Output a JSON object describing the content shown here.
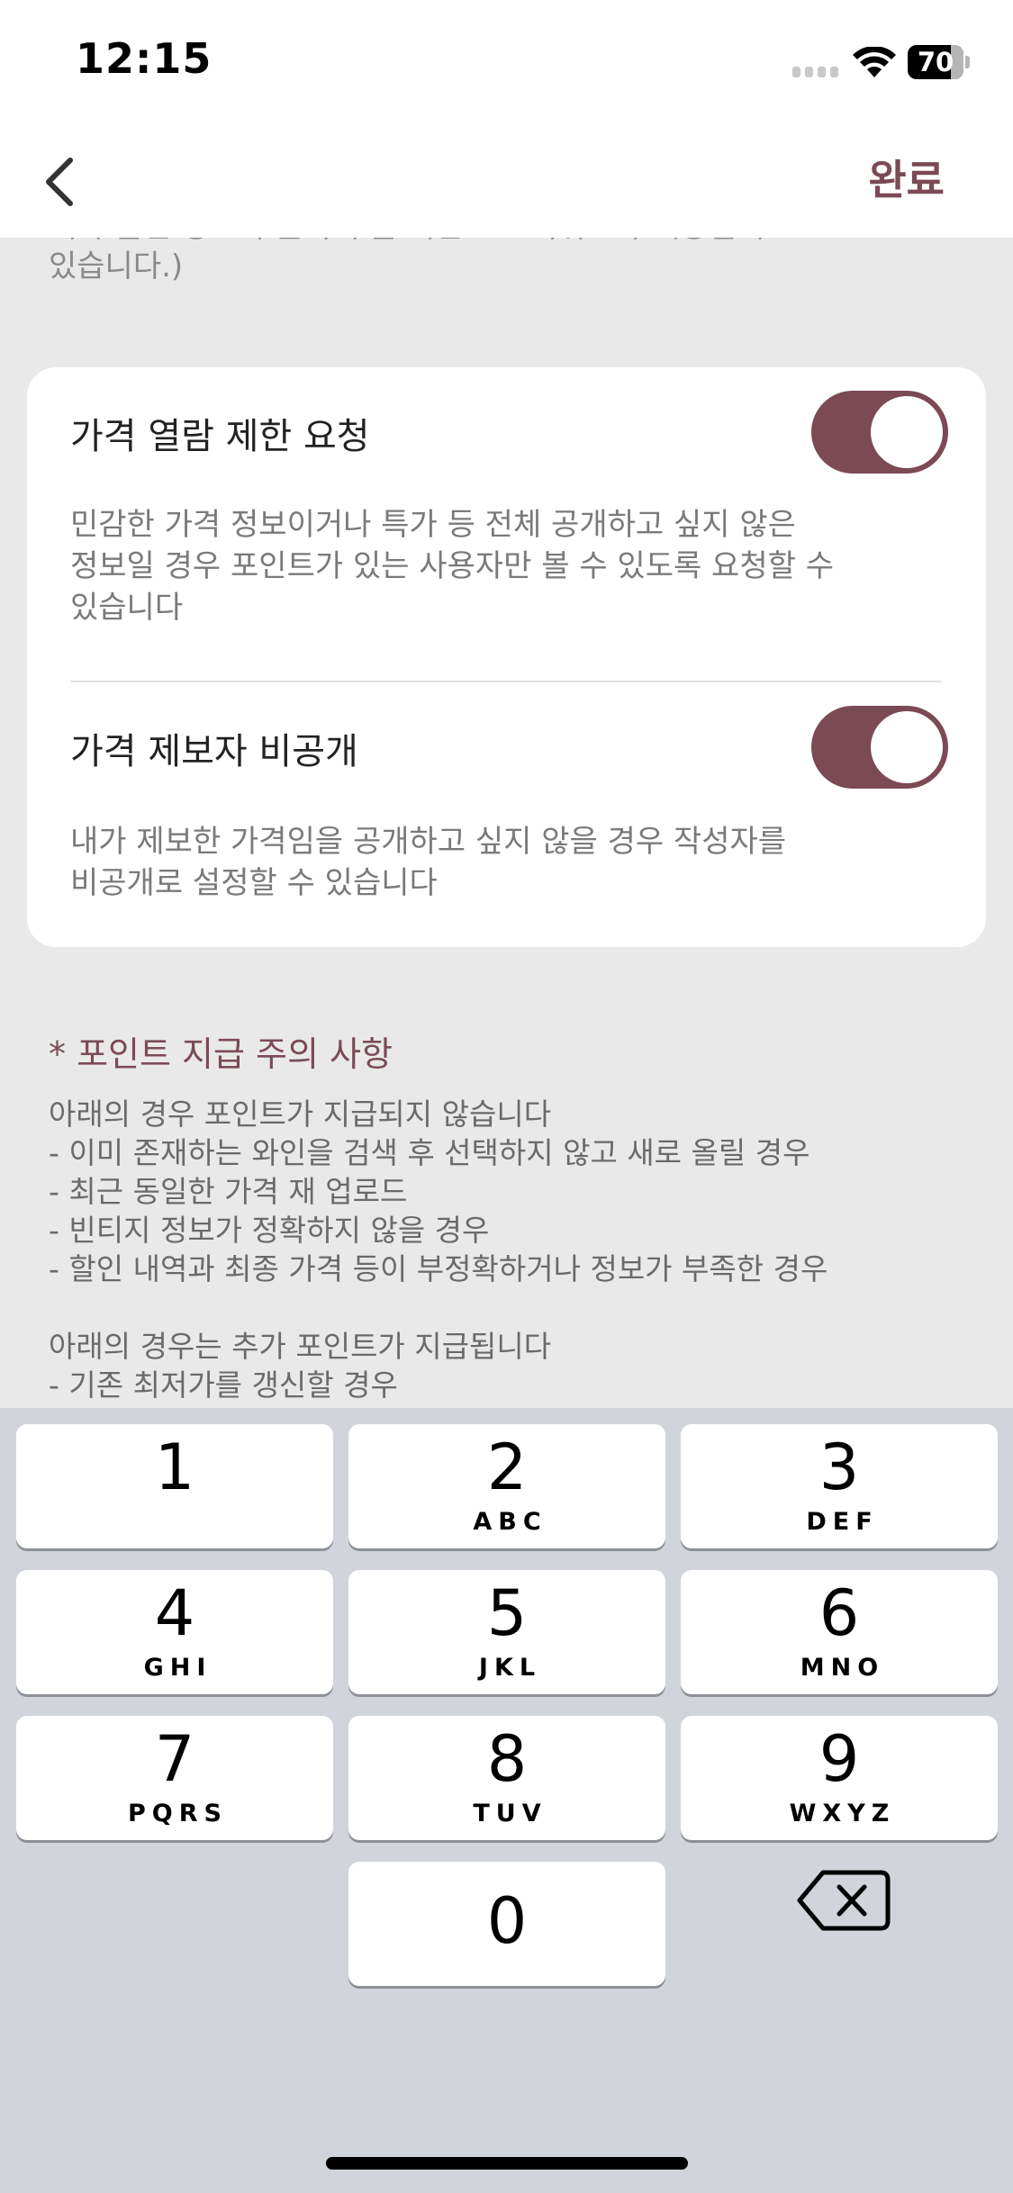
{
  "status_bar": {
    "time": "12:15",
    "battery_percent": "70"
  },
  "nav": {
    "done_label": "완료"
  },
  "content": {
    "prev_text_partial": "내가 올린 링크의 클릭 수를 기반으로 리워드가 제공될 수",
    "prev_text_end": "있습니다.)"
  },
  "settings": [
    {
      "title": "가격 열람 제한 요청",
      "description_lines": [
        "민감한 가격 정보이거나 특가 등 전체 공개하고 싶지 않은",
        "정보일 경우 포인트가 있는 사용자만 볼 수 있도록 요청할 수",
        "있습니다"
      ],
      "enabled": true
    },
    {
      "title": "가격 제보자 비공개",
      "description_lines": [
        "내가 제보한 가격임을 공개하고 싶지 않을 경우 작성자를",
        "비공개로 설정할 수 있습니다"
      ],
      "enabled": true
    }
  ],
  "notice": {
    "title": "* 포인트 지급 주의 사항",
    "lines": [
      "아래의 경우 포인트가 지급되지 않습니다",
      "- 이미 존재하는 와인을 검색 후 선택하지 않고 새로 올릴 경우",
      "- 최근 동일한 가격 재 업로드",
      "- 빈티지 정보가 정확하지 않을 경우",
      "- 할인 내역과 최종 가격 등이 부정확하거나 정보가 부족한 경우",
      "",
      "아래의 경우는 추가 포인트가 지급됩니다",
      "- 기존 최저가를 갱신할 경우"
    ]
  },
  "keyboard": {
    "keys": [
      {
        "digit": "1",
        "letters": ""
      },
      {
        "digit": "2",
        "letters": "ABC"
      },
      {
        "digit": "3",
        "letters": "DEF"
      },
      {
        "digit": "4",
        "letters": "GHI"
      },
      {
        "digit": "5",
        "letters": "JKL"
      },
      {
        "digit": "6",
        "letters": "MNO"
      },
      {
        "digit": "7",
        "letters": "PQRS"
      },
      {
        "digit": "8",
        "letters": "TUV"
      },
      {
        "digit": "9",
        "letters": "WXYZ"
      },
      {
        "digit": "0",
        "letters": ""
      }
    ]
  },
  "colors": {
    "accent": "#7b4a55",
    "background": "#e9e9e9",
    "keyboard_bg": "#d1d4da"
  },
  "icons": {
    "back": "chevron-left-icon",
    "wifi": "wifi-icon",
    "signal": "cellular-signal-icon",
    "battery": "battery-icon",
    "delete": "backspace-icon"
  }
}
